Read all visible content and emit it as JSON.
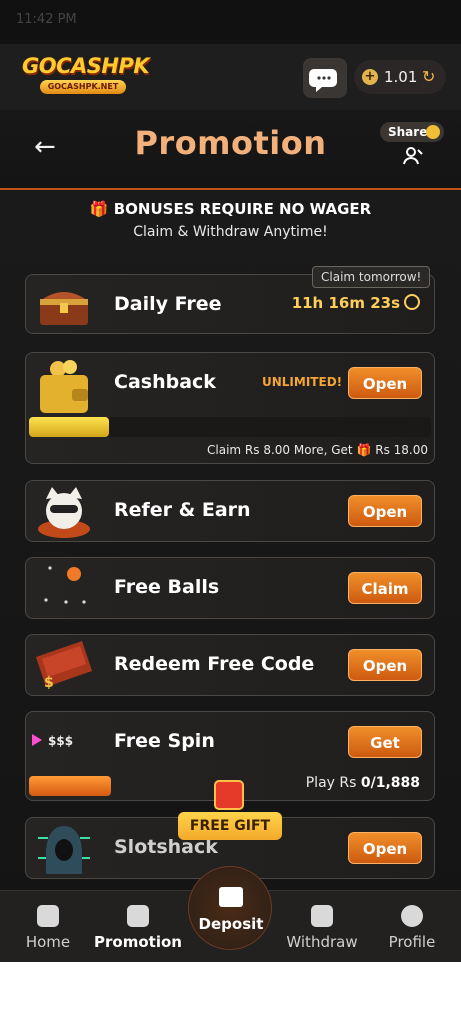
{
  "status_bar": {
    "time": "11:42 PM",
    "right_text": ""
  },
  "header": {
    "logo_main": "GOCASHPK",
    "logo_sub": "GOCASHPK.NET",
    "balance": "1.01"
  },
  "page": {
    "title": "Promotion",
    "share_label": "Share",
    "notice_line1": "BONUSES REQUIRE NO WAGER",
    "notice_line2": "Claim & Withdraw Anytime!"
  },
  "cards": {
    "daily_free": {
      "name": "Daily Free",
      "tag": "Claim tomorrow!",
      "timer": "11h 16m 23s"
    },
    "cashback": {
      "name": "Cashback",
      "badge": "UNLIMITED!",
      "button": "Open",
      "claim_prefix": "Claim Rs 8.00 More, Get",
      "claim_amount": "Rs 18.00"
    },
    "refer": {
      "name": "Refer & Earn",
      "button": "Open"
    },
    "balls": {
      "name": "Free Balls",
      "button": "Claim"
    },
    "redeem": {
      "name": "Redeem Free Code",
      "button": "Open"
    },
    "spin": {
      "name": "Free Spin",
      "button": "Get",
      "sss": "$$$",
      "play_prefix": "Play Rs",
      "play_value": "0/1,888"
    },
    "slots": {
      "name": "Slotshack",
      "button": "Open"
    }
  },
  "free_gift": "FREE GIFT",
  "nav": {
    "home": "Home",
    "promotion": "Promotion",
    "deposit": "Deposit",
    "withdraw": "Withdraw",
    "profile": "Profile"
  },
  "colors": {
    "accent": "#f08f2a",
    "background": "#161616",
    "title": "#f3b07a"
  }
}
